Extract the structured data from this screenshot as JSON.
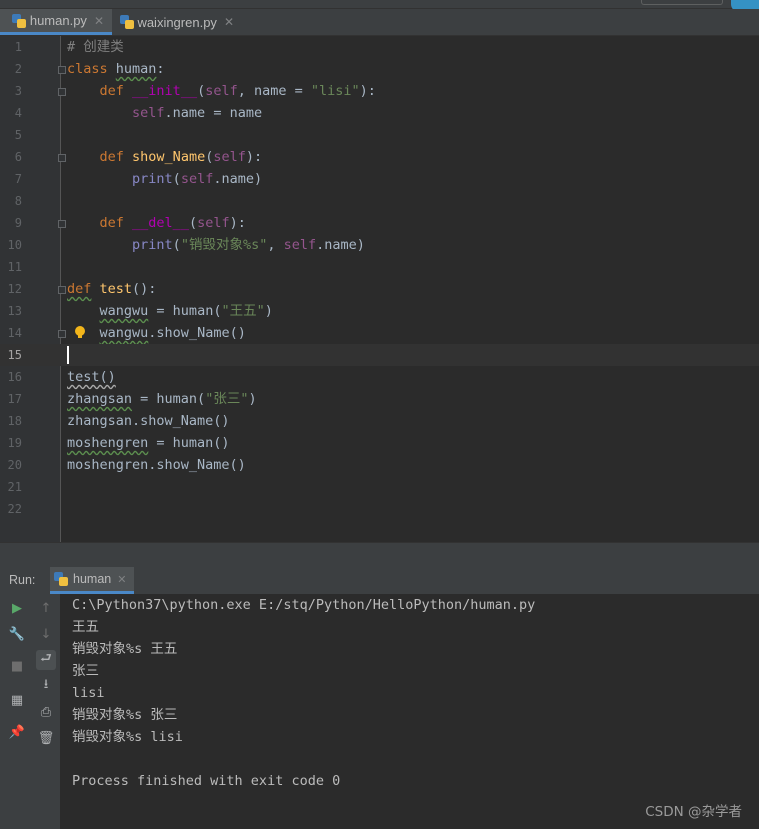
{
  "tabs": [
    {
      "label": "human.py",
      "active": true
    },
    {
      "label": "waixingren.py",
      "active": false
    }
  ],
  "editor": {
    "current_line": 15,
    "line_numbers": [
      "1",
      "2",
      "3",
      "4",
      "5",
      "6",
      "7",
      "8",
      "9",
      "10",
      "11",
      "12",
      "13",
      "14",
      "15",
      "16",
      "17",
      "18",
      "19",
      "20",
      "21",
      "22"
    ],
    "strings": {
      "l1_comment": "# 创建类",
      "kw_class": "class",
      "kw_def": "def",
      "cls_name": "human",
      "colon": ":",
      "init": "__init__",
      "del": "__del__",
      "self": "self",
      "l3_params_mid": ", name = ",
      "l3_default": "\"lisi\"",
      "l3_end": "):",
      "l4_rest": ".name = name",
      "show_Name": "show_Name",
      "paren_open": "(",
      "paren_close_colon": "):",
      "print": "print",
      "l7_rest": ".name)",
      "l10_str": "\"销毁对象%s\"",
      "l10_comma": ", ",
      "l10_rest": ".name)",
      "test_fn": "test",
      "l12_rest": "():",
      "wangwu": "wangwu",
      "l13_mid": " = human(",
      "l13_str": "\"王五\"",
      "close_paren": ")",
      "l14_rest": ".show_Name()",
      "l16": "test()",
      "zhangsan": "zhangsan",
      "l17_mid": " = human(",
      "l17_str": "\"张三\"",
      "l18": "zhangsan.show_Name()",
      "moshengren": "moshengren",
      "l19_rest": " = human()",
      "l20": "moshengren.show_Name()"
    }
  },
  "run_panel": {
    "label": "Run:",
    "tab": "human",
    "output": [
      "C:\\Python37\\python.exe E:/stq/Python/HelloPython/human.py",
      "王五",
      "销毁对象%s 王五",
      "张三",
      "lisi",
      "销毁对象%s 张三",
      "销毁对象%s lisi",
      "",
      "Process finished with exit code 0"
    ]
  },
  "icons": {
    "run": "play-icon",
    "wrench": "wrench-icon",
    "stop": "stop-icon",
    "layout": "layout-icon",
    "pin": "pin-icon",
    "up": "arrow-up-icon",
    "down": "arrow-down-icon",
    "wrap": "soft-wrap-icon",
    "scroll": "scroll-to-end-icon",
    "print": "print-icon",
    "trash": "trash-icon"
  },
  "watermark": "CSDN @杂学者"
}
